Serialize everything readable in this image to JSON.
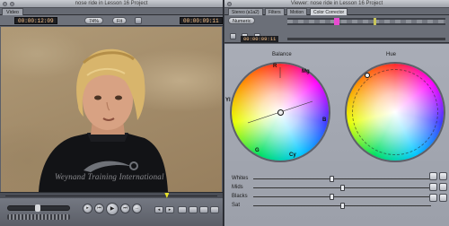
{
  "canvas": {
    "window_title": "nose ride in Lesson 16 Project",
    "tab": "Video",
    "timecode_left": "00:00:12:09",
    "zoom_label": "74%",
    "view_label": "Fit",
    "timecode_right": "00:00:09:11",
    "watermark_text": "Weynand Training International",
    "playhead_position": 0.76
  },
  "viewer": {
    "window_title": "Viewer: nose ride in Lesson 16 Project",
    "tabs": [
      "Stereo (a1a2)",
      "Filters",
      "Motion",
      "Color Corrector"
    ],
    "active_tab": "Color Corrector",
    "numeric_tab": "Numeric",
    "timecode": "00:00:09:11",
    "balance_label": "Balance",
    "hue_label": "Hue",
    "balance_wheel_letters": {
      "top": "R",
      "top_right": "Mg",
      "right": "B",
      "bottom_right": "Cy",
      "bottom_left": "G",
      "left": "Yl"
    },
    "sliders": [
      {
        "label": "Whites",
        "value": 0.44
      },
      {
        "label": "Mids",
        "value": 0.5
      },
      {
        "label": "Blacks",
        "value": 0.44
      },
      {
        "label": "Sat",
        "value": 0.5
      }
    ],
    "accent_colors": {
      "timecode": "#ffc68a",
      "range_mark": "#e84bd1",
      "playhead": "#e9e32a"
    }
  }
}
